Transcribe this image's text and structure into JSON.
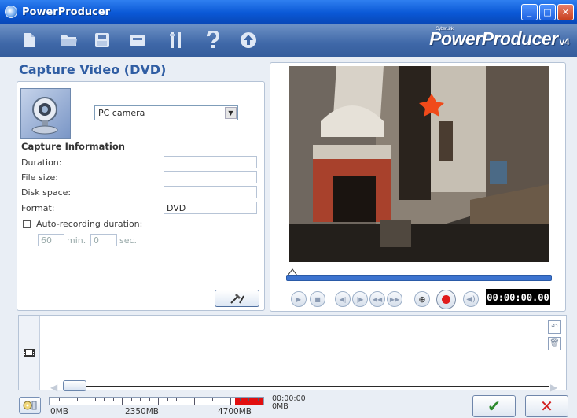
{
  "window": {
    "title": "PowerProducer"
  },
  "toolbar": {
    "icons": [
      "new-file-icon",
      "open-folder-icon",
      "save-icon",
      "burn-disc-icon",
      "settings-tools-icon",
      "help-icon",
      "upgrade-icon"
    ],
    "brand_small": "CyberLink",
    "brand": "PowerProducer",
    "version": "v4"
  },
  "capture_panel": {
    "title": "Capture Video (DVD)",
    "device": "PC camera",
    "section_title": "Capture Information",
    "fields": [
      {
        "label": "Duration:",
        "value": ""
      },
      {
        "label": "File size:",
        "value": ""
      },
      {
        "label": "Disk space:",
        "value": ""
      },
      {
        "label": "Format:",
        "value": "DVD"
      }
    ],
    "auto_recording": {
      "label": "Auto-recording duration:",
      "checked": false,
      "minutes_value": "60",
      "minutes_unit": "min.",
      "seconds_value": "0",
      "seconds_unit": "sec."
    }
  },
  "preview": {
    "timecode": "00:00:00.00",
    "seek_progress": 0.0
  },
  "bottom_bar": {
    "capacity_labels": [
      "0MB",
      "2350MB",
      "4700MB"
    ],
    "size_time": "00:00:00",
    "size_mb": "0MB",
    "ok_label": "✔",
    "cancel_label": "✕"
  }
}
